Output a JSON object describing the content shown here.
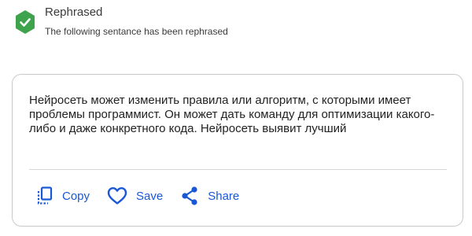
{
  "notification": {
    "title": "Rephrased",
    "subtitle": "The following sentance has been rephrased",
    "icon": "check-badge-icon",
    "color": "#3fa34d"
  },
  "result": {
    "text": "Нейросеть может изменить правила или алгоритм, с которыми имеет проблемы программист. Он может дать команду для оптимизации какого-либо и даже конкретного кода. Нейросеть выявит лучший"
  },
  "actions": {
    "copy_label": "Copy",
    "save_label": "Save",
    "share_label": "Share",
    "accent": "#1a57d6"
  }
}
